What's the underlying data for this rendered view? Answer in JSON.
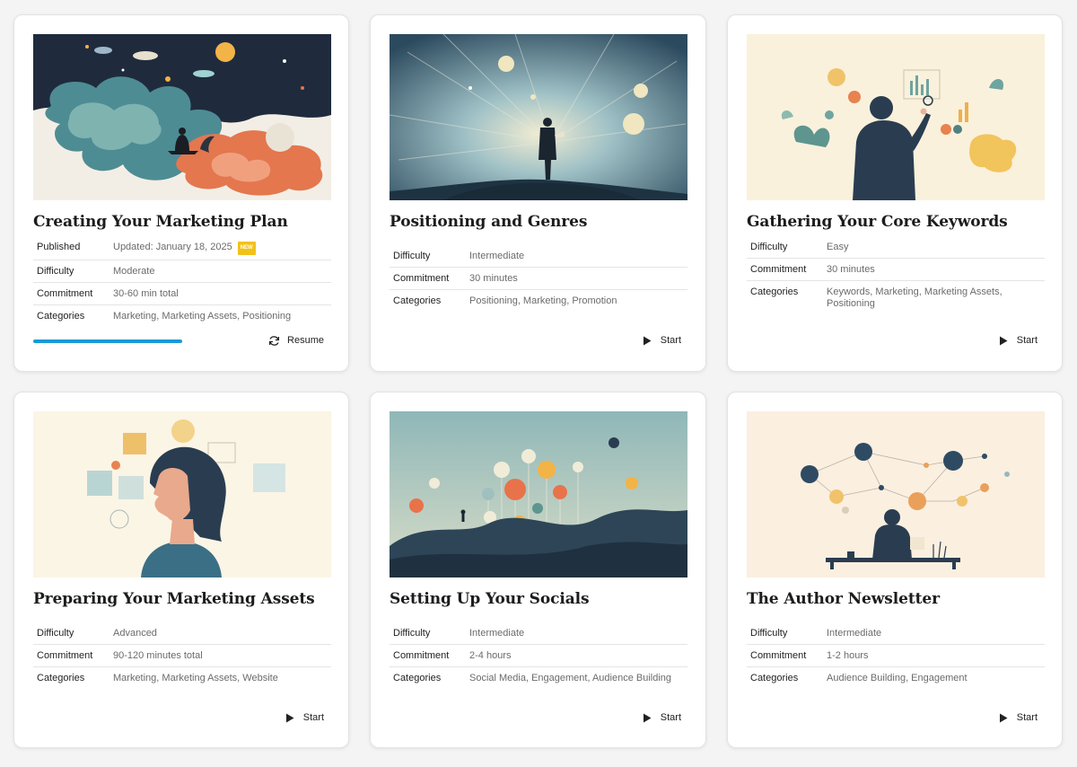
{
  "labels": {
    "published": "Published",
    "difficulty": "Difficulty",
    "commitment": "Commitment",
    "categories": "Categories"
  },
  "courses": [
    {
      "title": "Creating Your Marketing Plan",
      "published": "Updated: January 18, 2025",
      "badge": "NEW",
      "difficulty": "Moderate",
      "commitment": "30-60 min total",
      "categories": "Marketing, Marketing Assets, Positioning",
      "progress": 0.5,
      "action": "Resume",
      "action_icon": "refresh-icon"
    },
    {
      "title": "Positioning and Genres",
      "difficulty": "Intermediate",
      "commitment": "30 minutes",
      "categories": "Positioning, Marketing, Promotion",
      "action": "Start",
      "action_icon": "play-icon"
    },
    {
      "title": "Gathering Your Core Keywords",
      "difficulty": "Easy",
      "commitment": "30 minutes",
      "categories": "Keywords, Marketing, Marketing Assets, Positioning",
      "action": "Start",
      "action_icon": "play-icon"
    },
    {
      "title": "Preparing Your Marketing Assets",
      "difficulty": "Advanced",
      "commitment": "90-120 minutes total",
      "categories": "Marketing, Marketing Assets, Website",
      "action": "Start",
      "action_icon": "play-icon"
    },
    {
      "title": "Setting Up Your Socials",
      "difficulty": "Intermediate",
      "commitment": "2-4 hours",
      "categories": "Social Media, Engagement, Audience Building",
      "action": "Start",
      "action_icon": "play-icon"
    },
    {
      "title": "The Author Newsletter",
      "difficulty": "Intermediate",
      "commitment": "1-2 hours",
      "categories": "Audience Building, Engagement",
      "action": "Start",
      "action_icon": "play-icon"
    }
  ],
  "colors": {
    "progress": "#1a9ad6",
    "badge": "#f2c21a"
  }
}
